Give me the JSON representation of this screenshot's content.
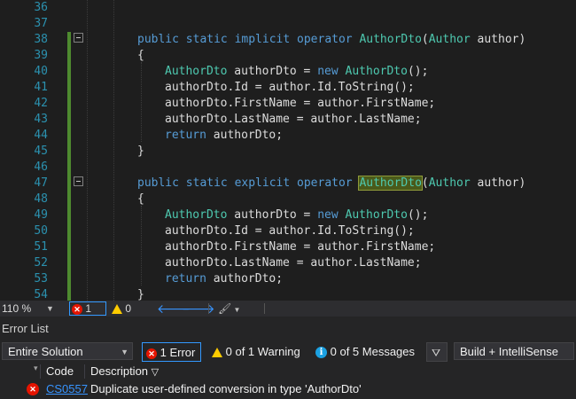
{
  "editor": {
    "lines": [
      {
        "num": "36",
        "tokens": []
      },
      {
        "num": "37",
        "tokens": []
      },
      {
        "num": "38",
        "tokens": [
          [
            "kw",
            "public static implicit operator "
          ],
          [
            "ty",
            "AuthorDto"
          ],
          [
            "p",
            "("
          ],
          [
            "ty",
            "Author"
          ],
          [
            "p",
            " author)"
          ]
        ]
      },
      {
        "num": "39",
        "tokens": [
          [
            "p",
            "{"
          ]
        ]
      },
      {
        "num": "40",
        "tokens": [
          [
            "ty",
            "AuthorDto"
          ],
          [
            "p",
            " authorDto = "
          ],
          [
            "kw",
            "new "
          ],
          [
            "ty",
            "AuthorDto"
          ],
          [
            "p",
            "();"
          ]
        ]
      },
      {
        "num": "41",
        "tokens": [
          [
            "p",
            "authorDto.Id = author.Id.ToString();"
          ]
        ]
      },
      {
        "num": "42",
        "tokens": [
          [
            "p",
            "authorDto.FirstName = author.FirstName;"
          ]
        ]
      },
      {
        "num": "43",
        "tokens": [
          [
            "p",
            "authorDto.LastName = author.LastName;"
          ]
        ]
      },
      {
        "num": "44",
        "tokens": [
          [
            "kw",
            "return"
          ],
          [
            "p",
            " authorDto;"
          ]
        ]
      },
      {
        "num": "45",
        "tokens": [
          [
            "p",
            "}"
          ]
        ]
      },
      {
        "num": "46",
        "tokens": []
      },
      {
        "num": "47",
        "tokens": [
          [
            "kw",
            "public static explicit operator "
          ],
          [
            "hl",
            "AuthorDto"
          ],
          [
            "p",
            "("
          ],
          [
            "ty",
            "Author"
          ],
          [
            "p",
            " author)"
          ]
        ]
      },
      {
        "num": "48",
        "tokens": [
          [
            "p",
            "{"
          ]
        ]
      },
      {
        "num": "49",
        "tokens": [
          [
            "ty",
            "AuthorDto"
          ],
          [
            "p",
            " authorDto = "
          ],
          [
            "kw",
            "new "
          ],
          [
            "ty",
            "AuthorDto"
          ],
          [
            "p",
            "();"
          ]
        ]
      },
      {
        "num": "50",
        "tokens": [
          [
            "p",
            "authorDto.Id = author.Id.ToString();"
          ]
        ]
      },
      {
        "num": "51",
        "tokens": [
          [
            "p",
            "authorDto.FirstName = author.FirstName;"
          ]
        ]
      },
      {
        "num": "52",
        "tokens": [
          [
            "p",
            "authorDto.LastName = author.LastName;"
          ]
        ]
      },
      {
        "num": "53",
        "tokens": [
          [
            "kw",
            "return"
          ],
          [
            "p",
            " authorDto;"
          ]
        ]
      },
      {
        "num": "54",
        "tokens": [
          [
            "p",
            "}"
          ]
        ]
      }
    ]
  },
  "status_strip": {
    "zoom": "110 %",
    "error_count": "1",
    "warning_count": "0"
  },
  "error_list": {
    "title": "Error List",
    "scope_selected": "Entire Solution",
    "errors_label": "1 Error",
    "warnings_label": "0 of 1 Warning",
    "messages_label": "0 of 5 Messages",
    "source_selected": "Build + IntelliSense",
    "columns": {
      "code": "Code",
      "description": "Description"
    },
    "rows": [
      {
        "code": "CS0557",
        "description": "Duplicate user-defined conversion in type 'AuthorDto'"
      }
    ]
  },
  "colors": {
    "keyword": "#569cd6",
    "type": "#4ec9b0",
    "line_number": "#2b91af",
    "error": "#e51400",
    "warning": "#ffcc00",
    "info": "#1ba1e2",
    "link": "#3794ff"
  }
}
